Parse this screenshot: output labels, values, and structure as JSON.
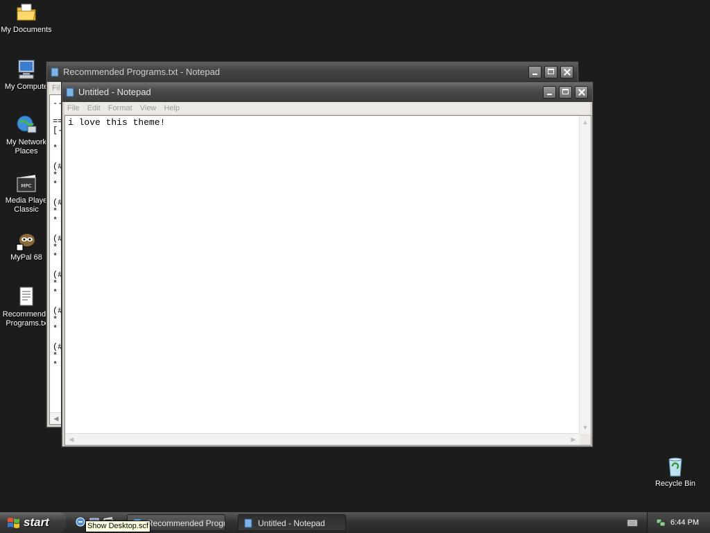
{
  "desktop": {
    "icons": [
      {
        "label": "My Documents",
        "icon": "folder-documents-icon"
      },
      {
        "label": "My Compute",
        "icon": "computer-icon"
      },
      {
        "label": "My Network\nPlaces",
        "icon": "network-icon"
      },
      {
        "label": "Media Playe\nClassic",
        "icon": "media-player-icon"
      },
      {
        "label": "MyPal 68",
        "icon": "mypal-browser-icon"
      },
      {
        "label": "Recommende\nPrograms.tx",
        "icon": "text-document-icon"
      },
      {
        "label": "Recycle Bin",
        "icon": "recycle-bin-icon"
      }
    ]
  },
  "back_window": {
    "title": "Recommended Programs.txt - Notepad",
    "menu_fragment": "Fil",
    "visible_lines": [
      "--",
      "",
      "==",
      "[-",
      "",
      "*",
      "",
      "(#",
      "*",
      "*",
      "",
      "(#",
      "*",
      "*",
      "",
      "(#",
      "*",
      "*",
      "",
      "(#",
      "*",
      "*",
      "",
      "(#",
      "*",
      "*",
      "",
      "(#",
      "*",
      "*"
    ]
  },
  "front_window": {
    "title": "Untitled - Notepad",
    "menu": [
      "File",
      "Edit",
      "Format",
      "View",
      "Help"
    ],
    "content": "i love this theme!"
  },
  "taskbar": {
    "start_label": "start",
    "tasks": [
      {
        "label": "Recommended Progr...",
        "active": false
      },
      {
        "label": "Untitled - Notepad",
        "active": true
      }
    ],
    "tooltip": "Show Desktop.scf",
    "clock": "6:44 PM"
  },
  "colors": {
    "desktop": "#1c1c1c",
    "titlebar": "#4a4a4a",
    "menu_text_disabled": "#9a9a9a"
  }
}
